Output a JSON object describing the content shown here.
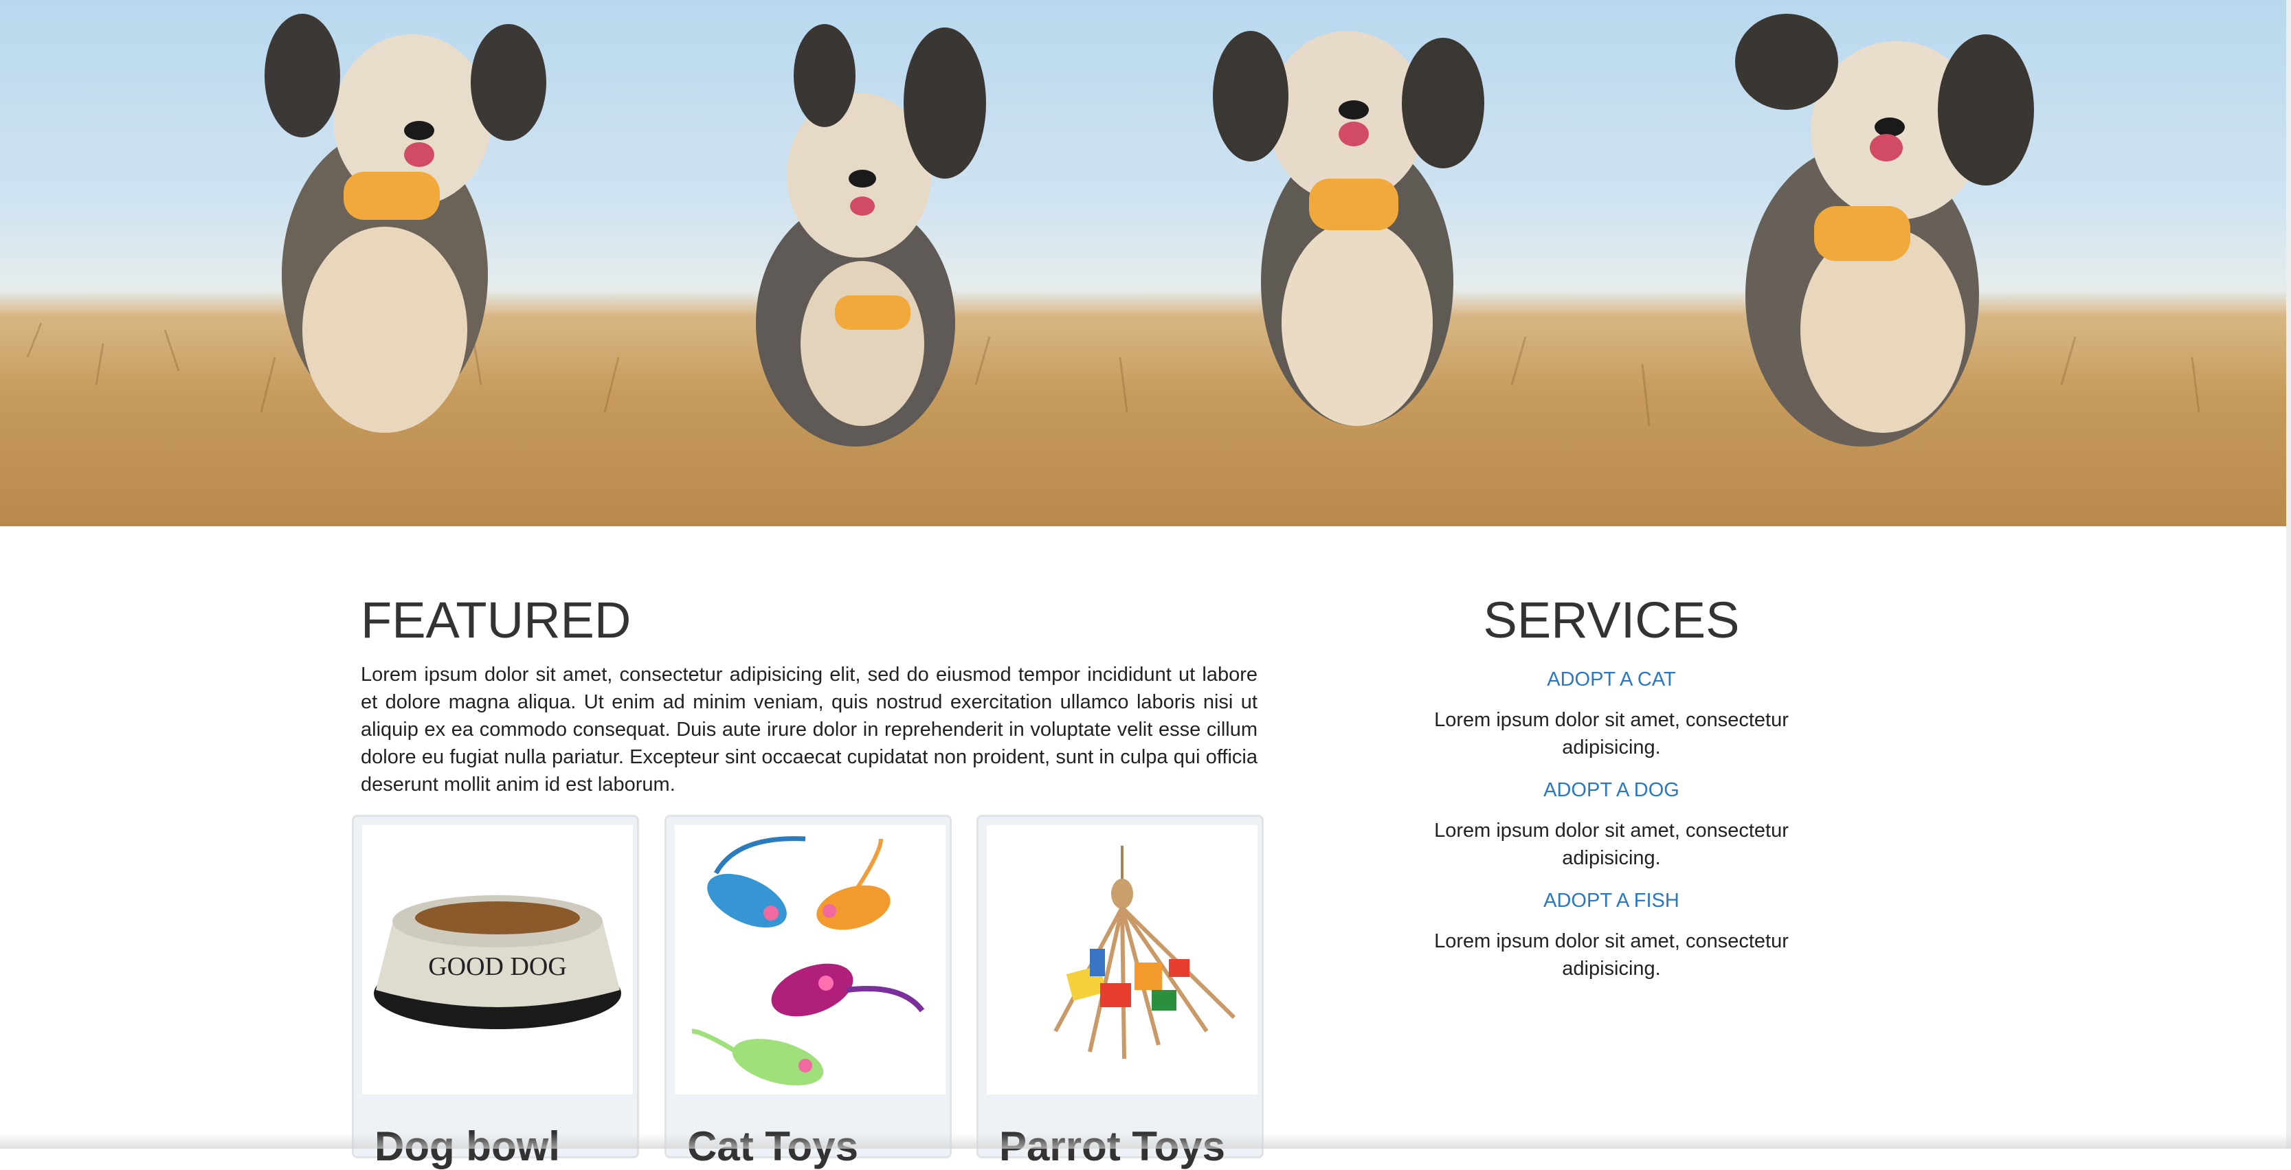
{
  "hero": {
    "image_name": "four-running-dogs-photo"
  },
  "featured": {
    "title": "FEATURED",
    "body": "Lorem ipsum dolor sit amet, consectetur adipisicing elit, sed do eiusmod tempor incididunt ut labore et dolore magna aliqua. Ut enim ad minim veniam, quis nostrud exercitation ullamco laboris nisi ut aliquip ex ea commodo consequat. Duis aute irure dolor in reprehenderit in voluptate velit esse cillum dolore eu fugiat nulla pariatur. Excepteur sint occaecat cupidatat non proident, sunt in culpa qui officia deserunt mollit anim id est laborum.",
    "cards": [
      {
        "title": "Dog bowl",
        "image_name": "dog-bowl-image",
        "bowl_text": "GOOD DOG"
      },
      {
        "title": "Cat Toys",
        "image_name": "cat-toys-image"
      },
      {
        "title": "Parrot Toys",
        "image_name": "parrot-toy-image"
      }
    ]
  },
  "services": {
    "title": "SERVICES",
    "items": [
      {
        "link": "ADOPT A CAT",
        "description": "Lorem ipsum dolor sit amet, consectetur adipisicing."
      },
      {
        "link": "ADOPT A DOG",
        "description": "Lorem ipsum dolor sit amet, consectetur adipisicing."
      },
      {
        "link": "ADOPT A FISH",
        "description": "Lorem ipsum dolor sit amet, consectetur adipisicing."
      }
    ]
  },
  "colors": {
    "link": "#2a77c2",
    "heading": "#333333",
    "card_border": "#dfe3e8"
  }
}
